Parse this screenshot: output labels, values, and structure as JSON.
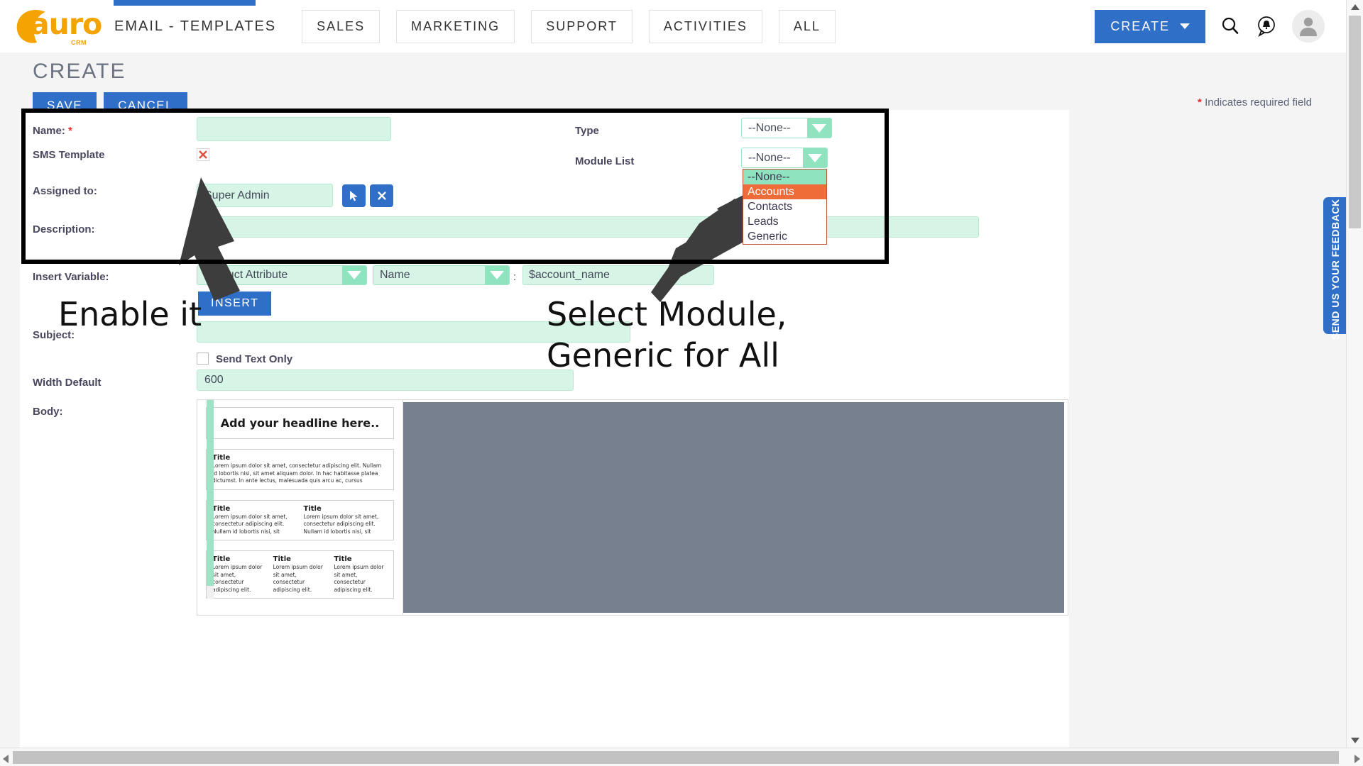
{
  "header": {
    "logo_text": "auro",
    "logo_sub": "CRM",
    "current_module": "EMAIL - TEMPLATES",
    "tabs": [
      {
        "label": "SALES"
      },
      {
        "label": "MARKETING"
      },
      {
        "label": "SUPPORT"
      },
      {
        "label": "ACTIVITIES"
      },
      {
        "label": "ALL"
      }
    ],
    "create_button": "CREATE",
    "icons": {
      "search": "search-icon",
      "notification": "notification-bell-icon",
      "avatar": "user-avatar-icon"
    }
  },
  "page": {
    "title": "CREATE",
    "required_note_star": "*",
    "required_note": "Indicates required field",
    "save_label": "SAVE",
    "cancel_label": "CANCEL"
  },
  "form": {
    "name": {
      "label": "Name:",
      "required": "*",
      "value": "",
      "placeholder": ""
    },
    "sms_template": {
      "label": "SMS Template",
      "state": "disabled",
      "icon": "red-x-icon"
    },
    "assigned_to": {
      "label": "Assigned to:",
      "value": "Super Admin",
      "pick_icon": "cursor-select-icon",
      "clear_icon": "clear-x-icon"
    },
    "description": {
      "label": "Description:",
      "value": ""
    },
    "type": {
      "label": "Type",
      "value": "--None--"
    },
    "module_list": {
      "label": "Module List",
      "value": "--None--",
      "open": true,
      "options": [
        {
          "label": "--None--",
          "state": "selected"
        },
        {
          "label": "Accounts",
          "state": "hovered"
        },
        {
          "label": "Contacts",
          "state": "normal"
        },
        {
          "label": "Leads",
          "state": "normal"
        },
        {
          "label": "Generic",
          "state": "normal"
        }
      ]
    },
    "insert_variable": {
      "label": "Insert Variable:",
      "module_value": "Product Attribute",
      "field_value": "Name",
      "separator": ":",
      "variable_value": "$account_name",
      "insert_label": "INSERT"
    },
    "subject": {
      "label": "Subject:",
      "value": ""
    },
    "send_text_only": {
      "label": "Send Text Only",
      "checked": false
    },
    "width_default": {
      "label": "Width Default",
      "value": "600"
    },
    "body": {
      "label": "Body:"
    }
  },
  "annotations": [
    {
      "text": "Enable it",
      "target": "sms-template-checkbox"
    },
    {
      "text": "Select Module,\nGeneric for All",
      "target": "module-list-dropdown"
    }
  ],
  "body_templates": {
    "headline": "Add your headline here..",
    "blocks": [
      {
        "columns": 1,
        "title": "Title",
        "text": "Lorem ipsum dolor sit amet, consectetur adipiscing elit. Nullam id lobortis nisi, sit amet aliquam dolor. In hac habitasse platea dictumst. In ante lectus, malesuada quis arcu ac, cursus"
      },
      {
        "columns": 2,
        "title": "Title",
        "text": "Lorem ipsum dolor sit amet, consectetur adipiscing elit. Nullam id lobortis nisi, sit"
      },
      {
        "columns": 3,
        "title": "Title",
        "text": "Lorem ipsum dolor sit amet, consectetur adipiscing elit."
      }
    ]
  },
  "feedback_tab": {
    "label": "SEND US YOUR FEEDBACK !"
  },
  "colors": {
    "brand_blue": "#2f6fc7",
    "logo_orange": "#f5a300",
    "field_green": "#d7f5e6",
    "accent_green": "#8fe3bf",
    "dropdown_hover": "#ef6c38",
    "required_red": "#e02b2b",
    "editor_gray": "#76808f"
  }
}
